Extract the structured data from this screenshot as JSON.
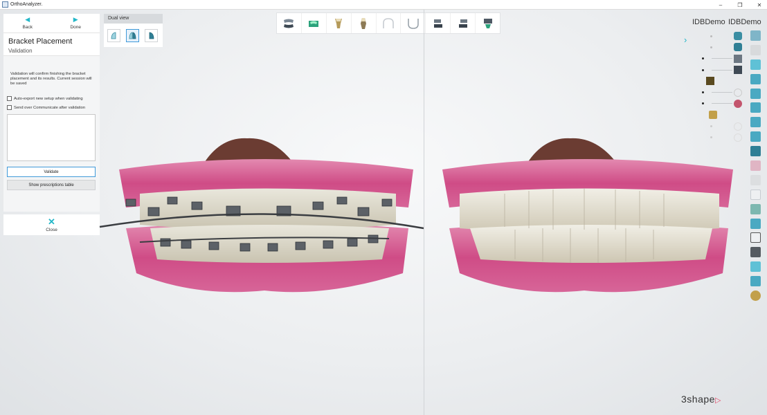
{
  "window": {
    "title": "OrthoAnalyzer.",
    "controls": [
      "–",
      "❐",
      "✕"
    ]
  },
  "nav": {
    "back_label": "Back",
    "done_label": "Done"
  },
  "step": {
    "title": "Bracket Placement",
    "subtitle": "Validation",
    "description": "Validation will confirm finishing the bracket placement and its results. Current session will be saved",
    "auto_export_label": "Auto-export new setup when validating",
    "auto_export_checked": false,
    "send_communicate_label": "Send over Communicate after validation",
    "send_communicate_checked": false,
    "notes_value": "",
    "validate_label": "Validate",
    "prescriptions_label": "Show prescriptions table",
    "close_label": "Close"
  },
  "dual_view": {
    "title": "Dual view",
    "modes": [
      "view-left-icon",
      "view-both-icon",
      "view-right-icon"
    ],
    "active_index": 1
  },
  "toolbar": {
    "items": [
      "upper-lower-view-icon",
      "model-base-icon",
      "tooth-side-icon",
      "tooth-lingual-icon",
      "upper-arch-icon",
      "lower-arch-icon",
      "bite-view-1-icon",
      "bite-view-2-icon",
      "occlusion-check-icon"
    ]
  },
  "right_labels": {
    "left": "IDBDemo",
    "right": "IDBDemo"
  },
  "brand": {
    "name": "3shape"
  },
  "colors": {
    "accent": "#23b7c8",
    "active_border": "#3f9ad9",
    "brand_triangle": "#e34b6a",
    "gum": "#d8538f"
  }
}
